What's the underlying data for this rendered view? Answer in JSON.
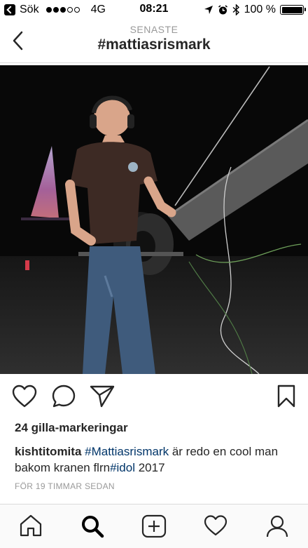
{
  "status_bar": {
    "back_app_label": "Sök",
    "carrier": "4G",
    "time": "08:21",
    "battery": "100 %"
  },
  "nav": {
    "subtitle": "SENASTE",
    "title": "#mattiasrismark"
  },
  "photo": {
    "description_icon": "photo"
  },
  "actions": {
    "like_icon": "heart-icon",
    "comment_icon": "comment-icon",
    "share_icon": "send-icon",
    "save_icon": "bookmark-icon"
  },
  "post": {
    "likes_text": "24 gilla-markeringar",
    "username": "kishtitomita",
    "hashtag1": "#Mattiasrismark",
    "caption_mid": " är redo en cool man bakom kranen flrn",
    "hashtag2": "#idol",
    "caption_end": " 2017",
    "timestamp": "FÖR 19 TIMMAR SEDAN"
  },
  "tabbar": {
    "items": [
      "home-icon",
      "search-icon",
      "add-icon",
      "activity-icon",
      "profile-icon"
    ]
  },
  "colors": {
    "hashtag": "#003569",
    "muted": "#999999",
    "text": "#262626"
  }
}
